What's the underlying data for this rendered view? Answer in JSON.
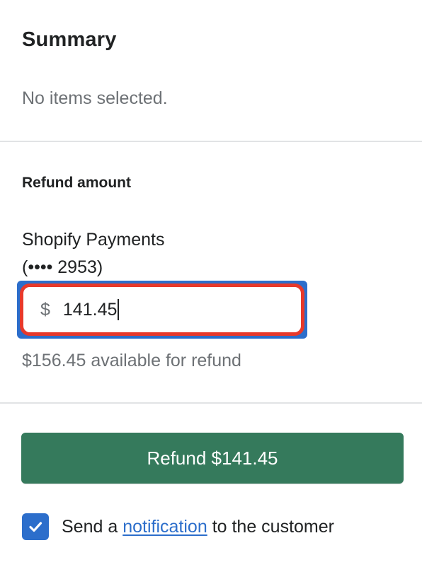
{
  "summary": {
    "title": "Summary",
    "empty_text": "No items selected."
  },
  "refund": {
    "heading": "Refund amount",
    "gateway_name": "Shopify Payments",
    "gateway_card": "(•••• 2953)",
    "currency_prefix": "$",
    "amount_value": "141.45",
    "available_text": "$156.45 available for refund",
    "button_label": "Refund $141.45"
  },
  "notification": {
    "checked": true,
    "label_before": "Send a",
    "link_text": "notification",
    "label_after": "to the customer",
    "checkbox_icon": "check-icon"
  },
  "colors": {
    "primary_button": "#357a5c",
    "focus_ring": "#2c6ecb",
    "highlight_border": "#e8392b",
    "link": "#2c6ecb",
    "muted_text": "#6d7175"
  }
}
